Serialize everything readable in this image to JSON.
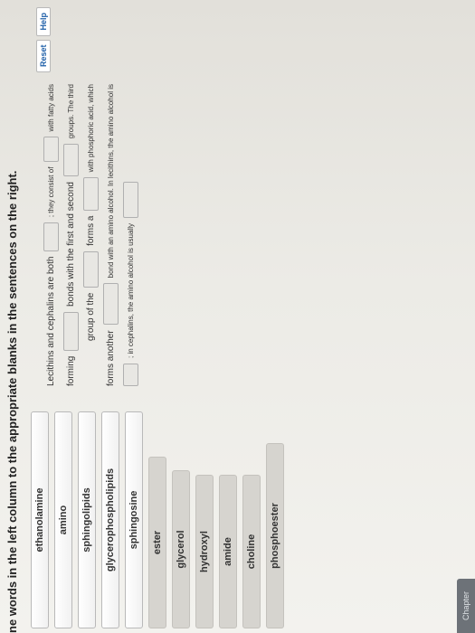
{
  "instructions": "ne words in the left column to the appropriate blanks in the sentences on the right.",
  "word_bank": [
    {
      "label": "ethanolamine"
    },
    {
      "label": "amino"
    },
    {
      "label": "sphingolipids"
    },
    {
      "label": "glycerophospholipids"
    },
    {
      "label": "sphingosine"
    },
    {
      "label": "ester"
    },
    {
      "label": "glycerol"
    },
    {
      "label": "hydroxyl"
    },
    {
      "label": "amide"
    },
    {
      "label": "choline"
    },
    {
      "label": "phosphoester"
    }
  ],
  "buttons": {
    "reset": "Reset",
    "help": "Help"
  },
  "sentence": {
    "p1": "Lecithins and cephalins are both",
    "p2": "; they consist of",
    "p3": "with fatty acids",
    "p4": "forming",
    "p5": "bonds with the first and second",
    "p6": "groups. The third",
    "p7": "group of the",
    "p8": "forms a",
    "p9": "with phosphoric acid, which",
    "p10": "forms another",
    "p11": "bond with an amino alcohol. In lecithins, the amino alcohol is",
    "p12": "; in cephalins, the amino alcohol is usually"
  },
  "footer_tab": "Chapter"
}
